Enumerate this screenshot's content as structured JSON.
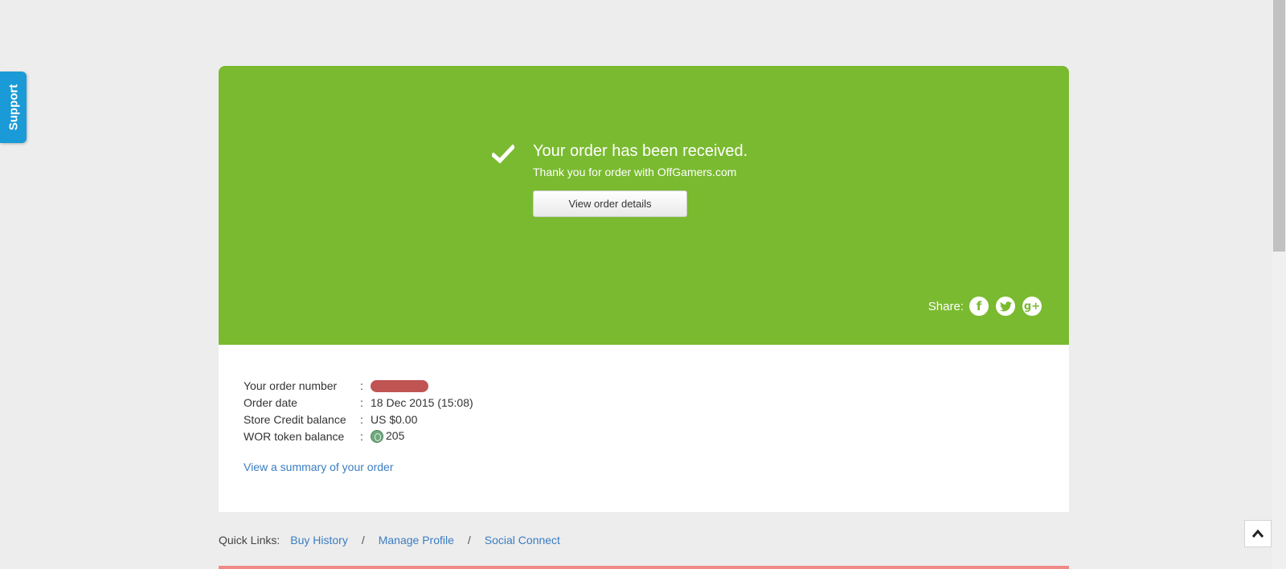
{
  "support_tab": {
    "label": "Support"
  },
  "hero": {
    "title": "Your order has been received.",
    "subtitle": "Thank you for order with OffGamers.com",
    "view_button_label": "View order details",
    "share_label": "Share:",
    "share_icons": [
      "facebook-icon",
      "twitter-icon",
      "google-plus-icon"
    ],
    "background_color": "#7aba30"
  },
  "order_info": {
    "rows": [
      {
        "key": "Your order number",
        "sep": ":",
        "value": ""
      },
      {
        "key": "Order date",
        "sep": ":",
        "value": "18 Dec 2015 (15:08)"
      },
      {
        "key": "Store Credit balance",
        "sep": ":",
        "value": "US $0.00"
      },
      {
        "key": "WOR token balance",
        "sep": ":",
        "value": "205"
      }
    ],
    "summary_link": "View a summary of your order"
  },
  "quick_links": {
    "label": "Quick Links:",
    "items": [
      "Buy History",
      "Manage Profile",
      "Social Connect"
    ],
    "separator": "/"
  },
  "colors": {
    "link": "#3a7dc1",
    "support_tab": "#1a9ad6",
    "redacted": "#c05452"
  }
}
